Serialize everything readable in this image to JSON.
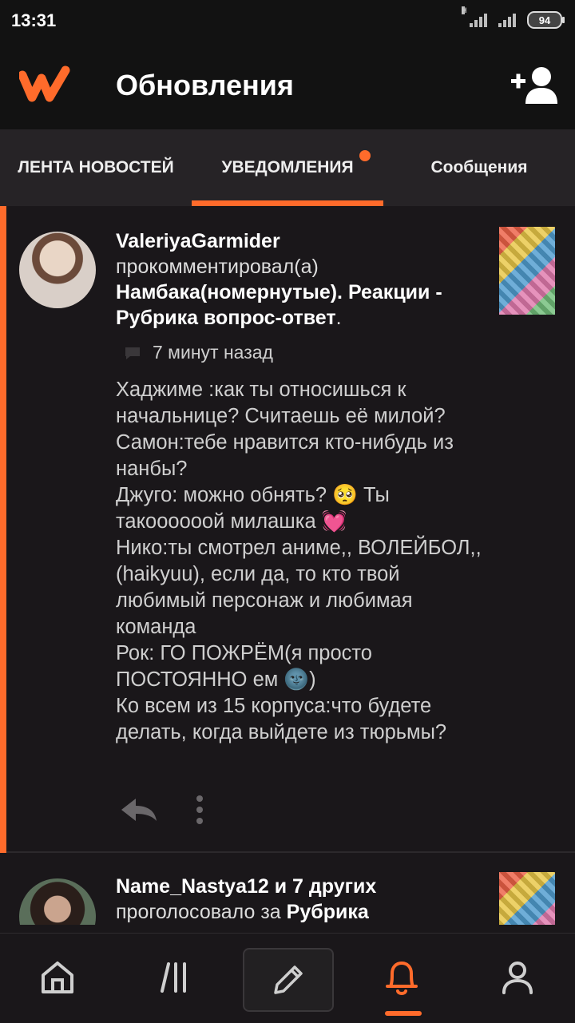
{
  "status_bar": {
    "time": "13:31",
    "network": "H",
    "battery": "94"
  },
  "app_bar": {
    "title": "Обновления",
    "logo_icon": "wattpad-logo",
    "action_icon": "add-user-icon"
  },
  "tabs": [
    {
      "label": "ЛЕНТА НОВОСТЕЙ",
      "active": false
    },
    {
      "label": "УВЕДОМЛЕНИЯ",
      "active": true,
      "has_dot": true
    },
    {
      "label": "Сообщения",
      "active": false
    }
  ],
  "notifications": [
    {
      "user": "ValeriyaGarmider",
      "action": "прокомментировал(а)",
      "story": "Намбака(номернутые). Реакции - Рубрика вопрос-ответ",
      "suffix": ".",
      "time": "7 минут назад",
      "comment": "Хаджиме :как ты относишься к начальнице? Считаешь её милой?\nСамон:тебе нравится кто-нибудь из нанбы?\nДжуго: можно обнять? 🥺 Ты такоооооой милашка 💓\nНико:ты смотрел аниме,, ВОЛЕЙБОЛ,, (haikyuu), если да, то кто твой любимый персонаж и любимая команда\nРок: ГО ПОЖРЁМ(я просто ПОСТОЯННО ем 🌚)\nКо всем из 15 корпуса:что будете делать, когда выйдете из тюрьмы?"
    },
    {
      "user": "Name_Nastya12 и 7 других",
      "action": "проголосовало за",
      "story": "Рубрика"
    }
  ],
  "bottom_nav": [
    {
      "name": "home",
      "icon": "home-icon"
    },
    {
      "name": "library",
      "icon": "library-icon"
    },
    {
      "name": "write",
      "icon": "pencil-icon"
    },
    {
      "name": "notifications",
      "icon": "bell-icon",
      "active": true
    },
    {
      "name": "profile",
      "icon": "profile-icon"
    }
  ],
  "colors": {
    "accent": "#ff6b2b",
    "background": "#1a171a",
    "bar": "#121212",
    "tabs": "#262326"
  }
}
